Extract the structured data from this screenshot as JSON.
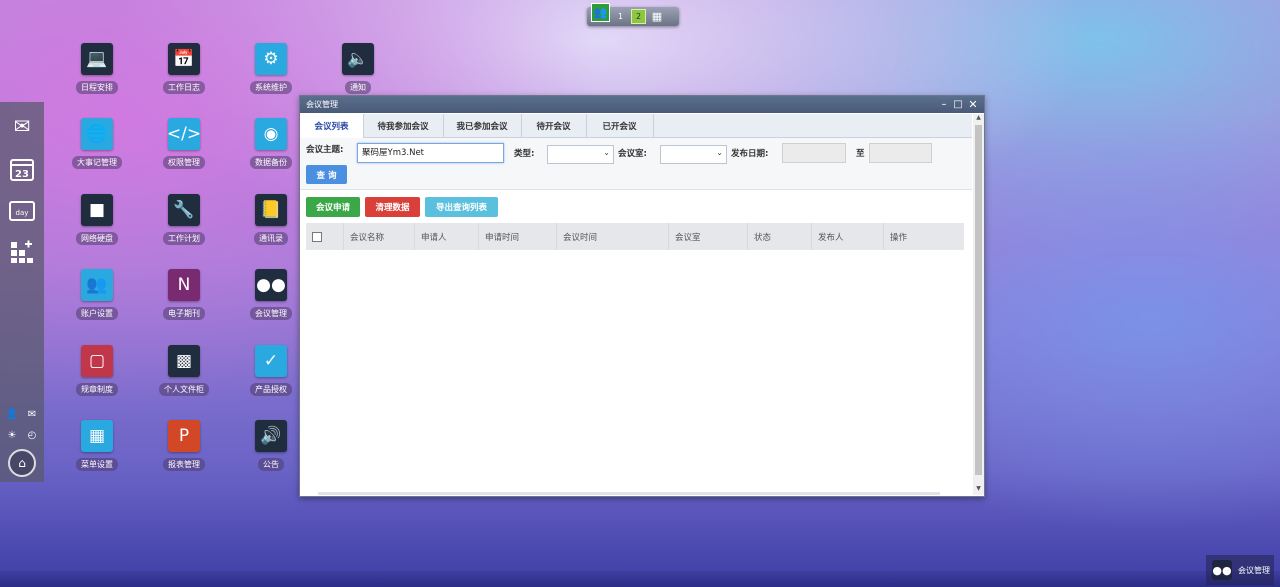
{
  "desktop_switcher": {
    "pages": [
      "1",
      "2"
    ],
    "active_page": "2"
  },
  "dock": {
    "icons": [
      "mail-icon",
      "calendar-icon",
      "day-icon",
      "add-app-icon"
    ],
    "calendar_day": "23",
    "day_label": "day"
  },
  "desktop_apps": [
    {
      "label": "日程安排",
      "icon": "schedule-icon",
      "color": "#1f2d3f"
    },
    {
      "label": "工作日志",
      "icon": "worklog-icon",
      "color": "#1f2d3f"
    },
    {
      "label": "系统维护",
      "icon": "system-maintenance-icon",
      "color": "#2aa8e0"
    },
    {
      "label": "通知",
      "icon": "speaker-icon",
      "color": "#1f2d3f"
    },
    {
      "label": "大事记管理",
      "icon": "globe-icon",
      "color": "#2aa8e0"
    },
    {
      "label": "权限管理",
      "icon": "code-icon",
      "color": "#2aa8e0"
    },
    {
      "label": "数据备份",
      "icon": "disc-icon",
      "color": "#2aa8e0"
    },
    {
      "label": "网络硬盘",
      "icon": "drive-icon",
      "color": "#1f2d3f"
    },
    {
      "label": "工作计划",
      "icon": "wrench-icon",
      "color": "#1f2d3f"
    },
    {
      "label": "通讯录",
      "icon": "address-book-icon",
      "color": "#1f2d3f"
    },
    {
      "label": "账户设置",
      "icon": "users-icon",
      "color": "#2aa8e0"
    },
    {
      "label": "电子期刊",
      "icon": "journal-icon",
      "color": "#7a2a70"
    },
    {
      "label": "会议管理",
      "icon": "meeting-icon",
      "color": "#1f2d3f"
    },
    {
      "label": "规章制度",
      "icon": "wallet-icon",
      "color": "#c0374a"
    },
    {
      "label": "个人文件柜",
      "icon": "cabinet-icon",
      "color": "#1f2d3f"
    },
    {
      "label": "产品授权",
      "icon": "monitor-check-icon",
      "color": "#2aa8e0"
    },
    {
      "label": "菜单设置",
      "icon": "menu-grid-icon",
      "color": "#2aa8e0"
    },
    {
      "label": "报表管理",
      "icon": "powerpoint-icon",
      "color": "#d24726"
    },
    {
      "label": "公告",
      "icon": "volume-icon",
      "color": "#1f2d3f"
    }
  ],
  "window": {
    "title": "会议管理",
    "tabs": [
      "会议列表",
      "待我参加会议",
      "我已参加会议",
      "待开会议",
      "已开会议"
    ],
    "active_tab": "会议列表",
    "search": {
      "topic_label": "会议主题:",
      "topic_value": "聚码屋Ym3.Net",
      "type_label": "类型:",
      "room_label": "会议室:",
      "date_label": "发布日期:",
      "to_label": "至",
      "query_button": "查 询"
    },
    "actions": {
      "apply": "会议申请",
      "clear": "清理数据",
      "export": "导出查询列表"
    },
    "columns": [
      "会议名称",
      "申请人",
      "申请时间",
      "会议时间",
      "会议室",
      "状态",
      "发布人",
      "操作"
    ]
  },
  "taskbar": {
    "item_label": "会议管理"
  }
}
